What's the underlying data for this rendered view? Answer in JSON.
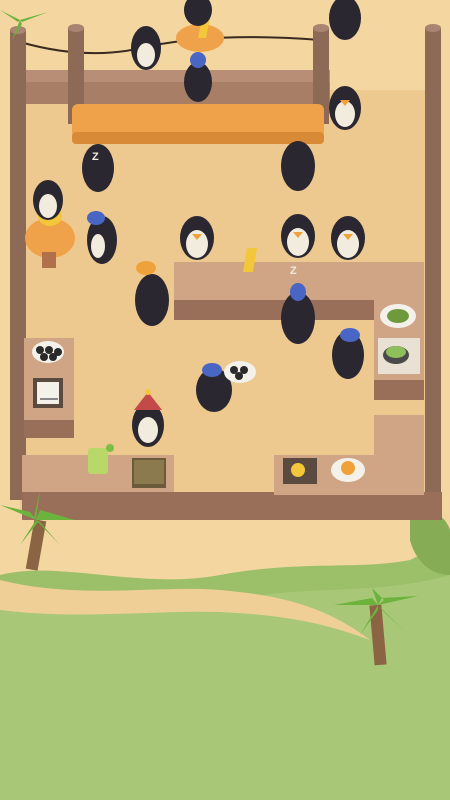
{
  "scene": {
    "name": "penguin-sushi-restaurant",
    "colors": {
      "sand": "#f4d6a0",
      "floor": "#e9c38a",
      "counter": "#cfa585",
      "counter_dark": "#9a6f5a",
      "post": "#8c6a55",
      "orange_table": "#f0a24a",
      "grass": "#9cbf6a",
      "grass_dark": "#86ad56",
      "penguin_body": "#2a2730",
      "penguin_belly": "#f2ecdf",
      "beak": "#f0a23a",
      "chef_hat": "#4a66c4",
      "coin_gold": "#f4c63a",
      "palm_leaf": "#6cb33e",
      "palm_trunk": "#8b6543"
    },
    "icons": {
      "sleep": "zz-icon",
      "coin": "gold-coin-icon",
      "sushi": "sushi-plate-icon",
      "drink": "green-drink-icon",
      "palm": "palm-tree-icon"
    },
    "sleep_text": "Z"
  }
}
